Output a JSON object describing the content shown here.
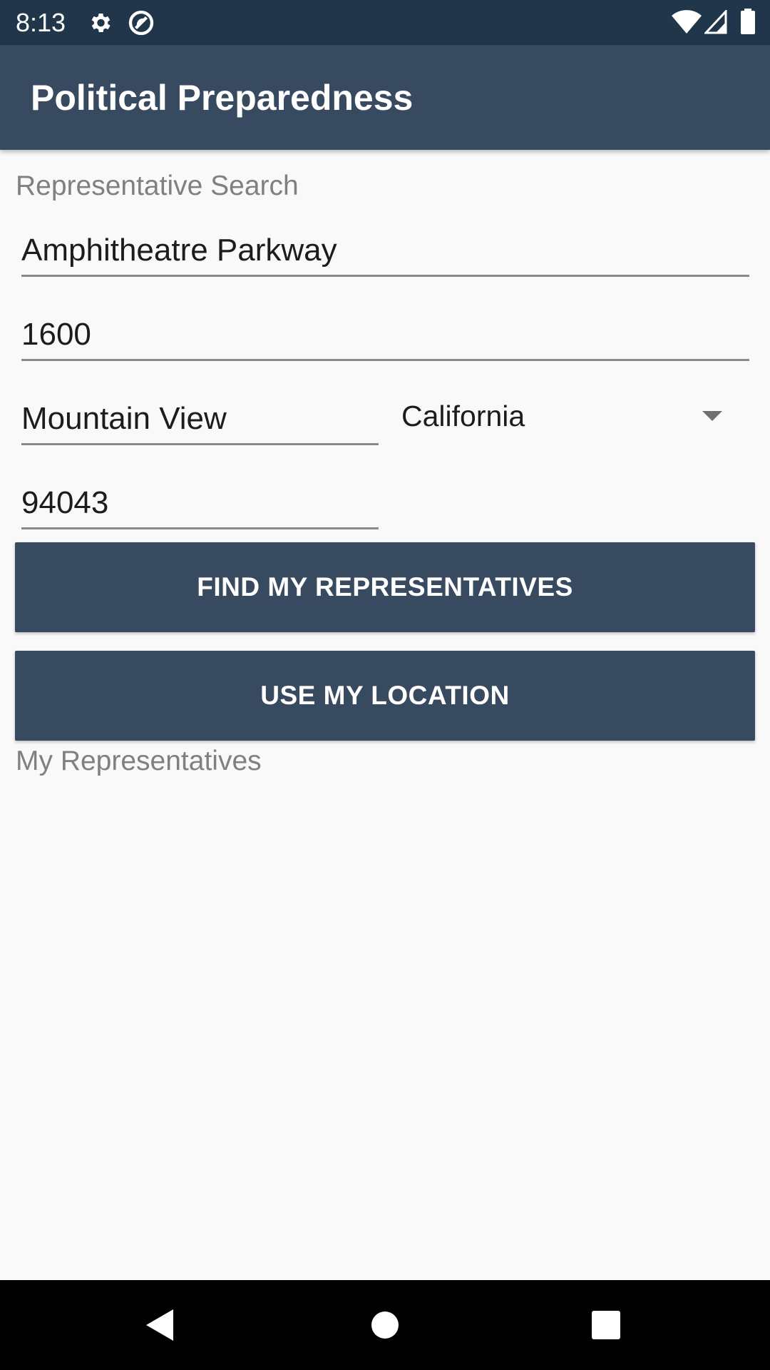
{
  "status_bar": {
    "time": "8:13",
    "icons_left": [
      "settings-icon",
      "app-notification-icon"
    ],
    "icons_right": [
      "wifi-icon",
      "cell-signal-icon",
      "battery-icon"
    ]
  },
  "app_bar": {
    "title": "Political Preparedness"
  },
  "search": {
    "section_label": "Representative Search",
    "address_line_1": "Amphitheatre Parkway",
    "address_line_2": "1600",
    "city": "Mountain View",
    "state": "California",
    "zip": "94043",
    "find_button_label": "FIND MY REPRESENTATIVES",
    "location_button_label": "USE MY LOCATION"
  },
  "results": {
    "section_label": "My Representatives"
  },
  "nav_bar": {
    "buttons": [
      "back-icon",
      "home-icon",
      "recents-icon"
    ]
  },
  "colors": {
    "status_bar": "#21364b",
    "primary": "#374a5f",
    "background": "#faf9fa",
    "label_gray": "#808080"
  }
}
